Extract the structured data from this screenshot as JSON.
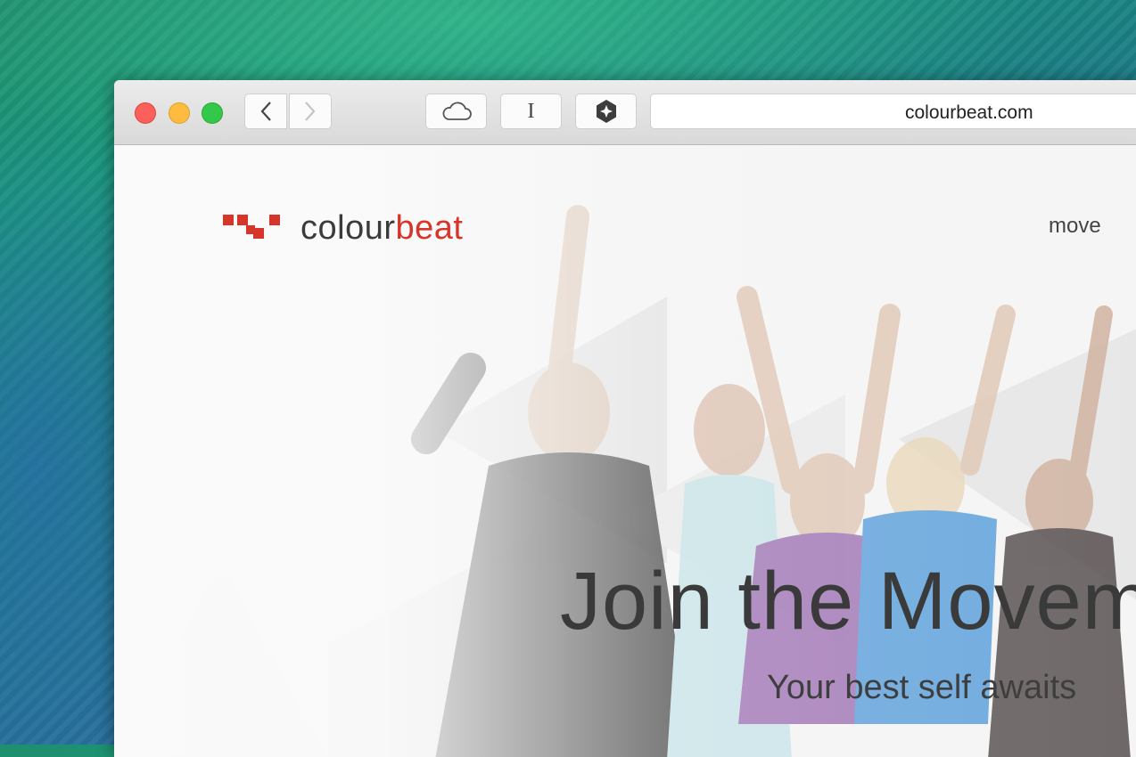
{
  "browser": {
    "url": "colourbeat.com",
    "reader_glyph": "I",
    "buttons": [
      "back",
      "forward",
      "icloud-tabs",
      "reader",
      "extension"
    ]
  },
  "site": {
    "logo_left": "colour",
    "logo_right": "beat",
    "nav_item": "move",
    "hero_title": "Join the Movem",
    "hero_subtitle": "Your best self awaits"
  },
  "colors": {
    "brand_red": "#d7352a",
    "text_dark": "#3a3a3a",
    "close": "#fc605c",
    "minimize": "#fdbc40",
    "maximize": "#34c84a"
  }
}
